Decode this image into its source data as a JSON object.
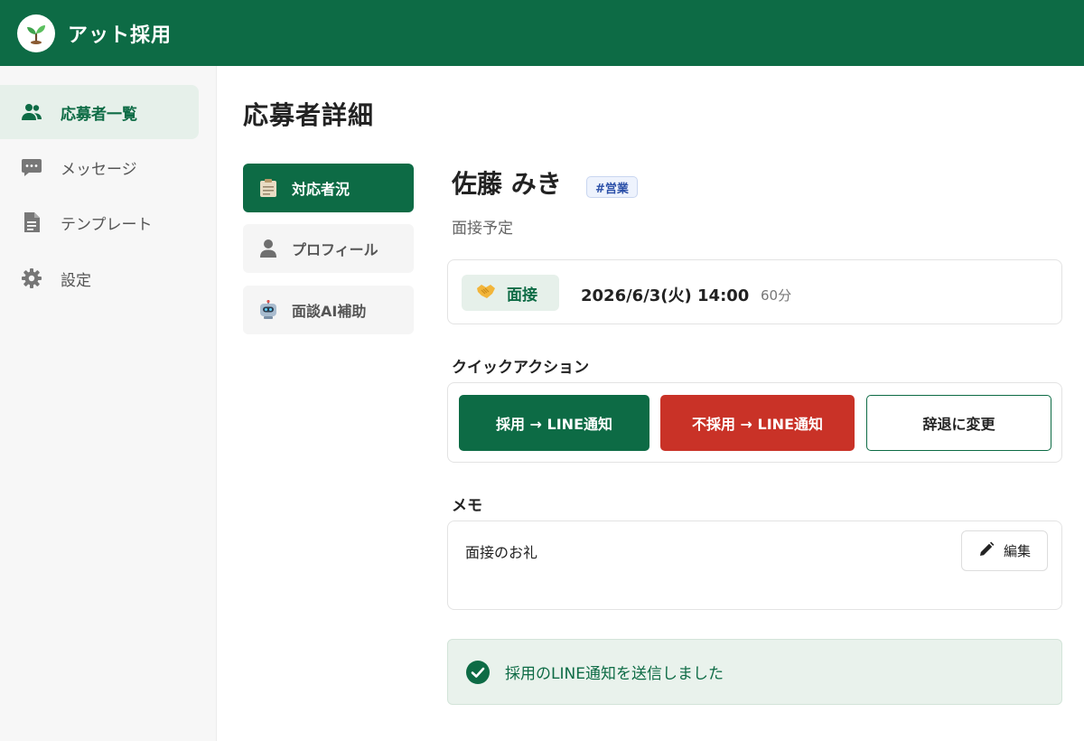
{
  "header": {
    "app_title": "アット採用",
    "brand_color": "#0d6b45",
    "logo_icon": "sprout-icon"
  },
  "sidebar": {
    "items": [
      {
        "label": "応募者一覧",
        "icon": "users-icon",
        "active": true
      },
      {
        "label": "メッセージ",
        "icon": "message-icon",
        "active": false
      },
      {
        "label": "テンプレート",
        "icon": "document-icon",
        "active": false
      },
      {
        "label": "設定",
        "icon": "gear-icon",
        "active": false
      }
    ]
  },
  "main": {
    "page_title": "応募者詳細",
    "tabs": [
      {
        "label": "対応者況",
        "icon": "clipboard-icon",
        "active": true
      },
      {
        "label": "プロフィール",
        "icon": "person-icon",
        "active": false
      },
      {
        "label": "面談AI補助",
        "icon": "robot-icon",
        "active": false
      }
    ],
    "applicant": {
      "name": "佐藤 みき",
      "tag": "#営業",
      "status": "面接予定"
    },
    "interview": {
      "badge_label": "面接",
      "badge_icon": "handshake-icon",
      "datetime": "2026/6/3(火) 14:00",
      "duration": "60分"
    },
    "quick_actions": {
      "title": "クイックアクション",
      "hire_label": "採用 → LINE通知",
      "reject_label": "不採用 → LINE通知",
      "decline_label": "辞退に変更",
      "reject_color": "#c93227"
    },
    "memo": {
      "title": "メモ",
      "text": "面接のお礼",
      "edit_label": "編集"
    },
    "toast": {
      "message": "採用のLINE通知を送信しました",
      "icon": "check-circle-icon"
    }
  }
}
